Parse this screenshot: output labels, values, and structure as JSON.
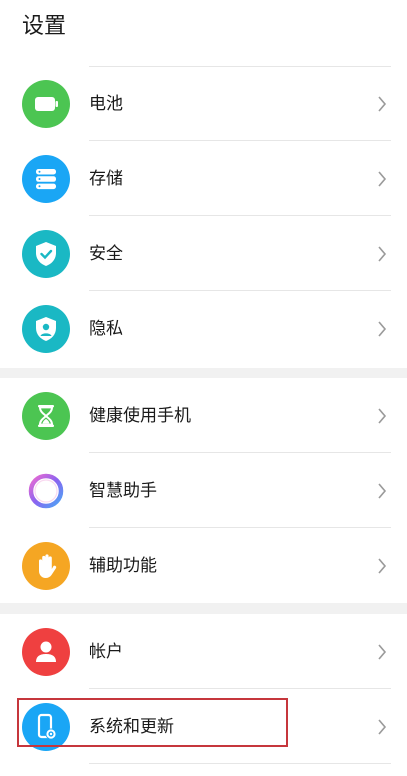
{
  "header": {
    "title": "设置"
  },
  "groups": [
    {
      "items": [
        {
          "label": "电池",
          "icon": "battery-icon",
          "color": "#4cc552"
        },
        {
          "label": "存储",
          "icon": "storage-icon",
          "color": "#1aa6f5"
        },
        {
          "label": "安全",
          "icon": "security-shield-icon",
          "color": "#1ab8c4"
        },
        {
          "label": "隐私",
          "icon": "privacy-icon",
          "color": "#1ab8c4"
        }
      ]
    },
    {
      "items": [
        {
          "label": "健康使用手机",
          "icon": "hourglass-icon",
          "color": "#4cc552"
        },
        {
          "label": "智慧助手",
          "icon": "assistant-ring-icon",
          "color": "#ffffff"
        },
        {
          "label": "辅助功能",
          "icon": "hand-icon",
          "color": "#f5a623"
        }
      ]
    },
    {
      "items": [
        {
          "label": "帐户",
          "icon": "account-icon",
          "color": "#ef4040"
        },
        {
          "label": "系统和更新",
          "icon": "system-update-icon",
          "color": "#1aa6f5"
        }
      ]
    }
  ],
  "highlight_color": "#c6363c"
}
